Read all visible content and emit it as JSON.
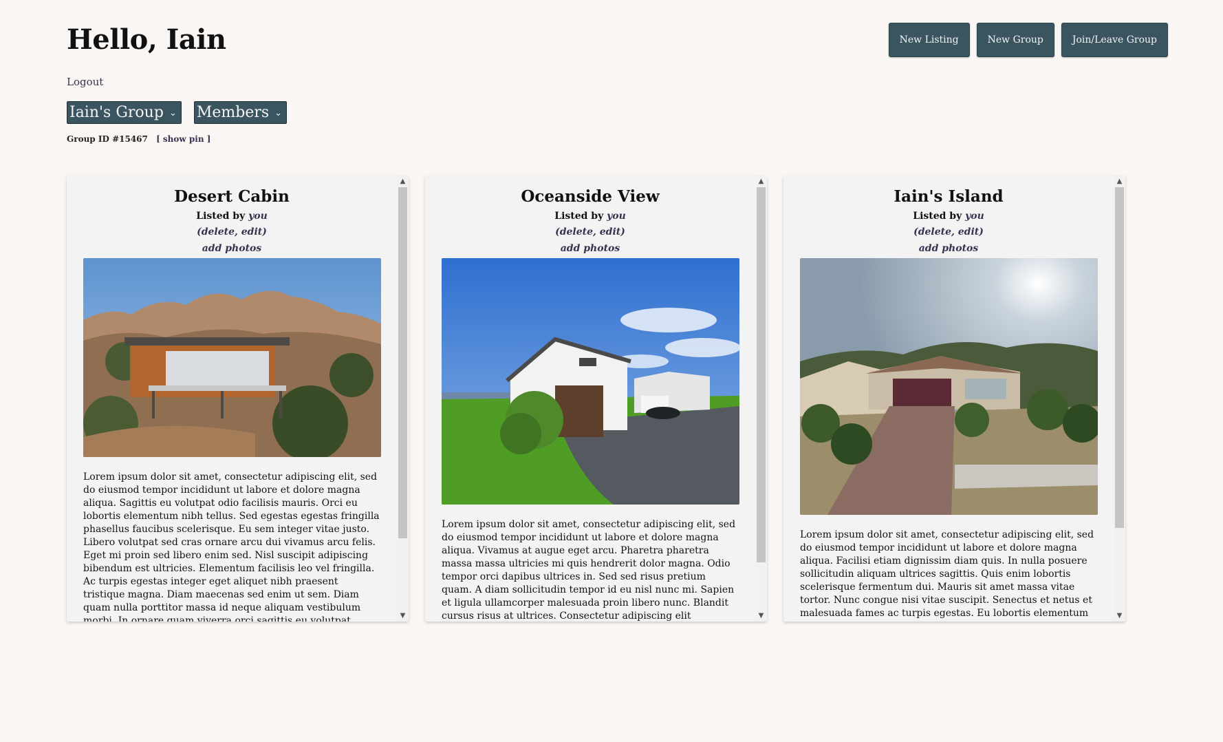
{
  "header": {
    "greeting": "Hello, Iain",
    "logout": "Logout",
    "buttons": {
      "new_listing": "New Listing",
      "new_group": "New Group",
      "join_leave": "Join/Leave Group"
    }
  },
  "selects": {
    "group": "Iain's Group",
    "members": "Members"
  },
  "group_info": {
    "id_text": "Group ID #15467",
    "show_pin": "[ show pin ]"
  },
  "listings": [
    {
      "title": "Desert Cabin",
      "listed_by_label": "Listed by",
      "listed_by": "you",
      "actions": "(delete, edit)",
      "add_photos": "add photos",
      "description": "Lorem ipsum dolor sit amet, consectetur adipiscing elit, sed do eiusmod tempor incididunt ut labore et dolore magna aliqua. Sagittis eu volutpat odio facilisis mauris. Orci eu lobortis elementum nibh tellus. Sed egestas egestas fringilla phasellus faucibus scelerisque. Eu sem integer vitae justo. Libero volutpat sed cras ornare arcu dui vivamus arcu felis. Eget mi proin sed libero enim sed. Nisl suscipit adipiscing bibendum est ultricies. Elementum facilisis leo vel fringilla. Ac turpis egestas integer eget aliquet nibh praesent tristique magna. Diam maecenas sed enim ut sem. Diam quam nulla porttitor massa id neque aliquam vestibulum morbi. In ornare quam viverra orci sagittis eu volutpat. Cursus sit amet dictum sit amet justo donec enim."
    },
    {
      "title": "Oceanside View",
      "listed_by_label": "Listed by",
      "listed_by": "you",
      "actions": "(delete, edit)",
      "add_photos": "add photos",
      "description": "Lorem ipsum dolor sit amet, consectetur adipiscing elit, sed do eiusmod tempor incididunt ut labore et dolore magna aliqua. Vivamus at augue eget arcu. Pharetra pharetra massa massa ultricies mi quis hendrerit dolor magna. Odio tempor orci dapibus ultrices in. Sed sed risus pretium quam. A diam sollicitudin tempor id eu nisl nunc mi. Sapien et ligula ullamcorper malesuada proin libero nunc. Blandit cursus risus at ultrices. Consectetur adipiscing elit pellentesque habitant morbi."
    },
    {
      "title": "Iain's Island",
      "listed_by_label": "Listed by",
      "listed_by": "you",
      "actions": "(delete, edit)",
      "add_photos": "add photos",
      "description": "Lorem ipsum dolor sit amet, consectetur adipiscing elit, sed do eiusmod tempor incididunt ut labore et dolore magna aliqua. Facilisi etiam dignissim diam quis. In nulla posuere sollicitudin aliquam ultrices sagittis. Quis enim lobortis scelerisque fermentum dui. Mauris sit amet massa vitae tortor. Nunc congue nisi vitae suscipit. Senectus et netus et malesuada fames ac turpis egestas. Eu lobortis elementum nibh tellus molestie nunc non blandit massa."
    }
  ],
  "icons": {
    "dropdown": "chevron-down-icon",
    "scroll_up": "chevron-up-icon",
    "scroll_down": "chevron-down-icon"
  },
  "colors": {
    "background": "#faf6f4",
    "button": "#3b5560",
    "link": "#3a3050",
    "card": "#f3f3f3"
  }
}
